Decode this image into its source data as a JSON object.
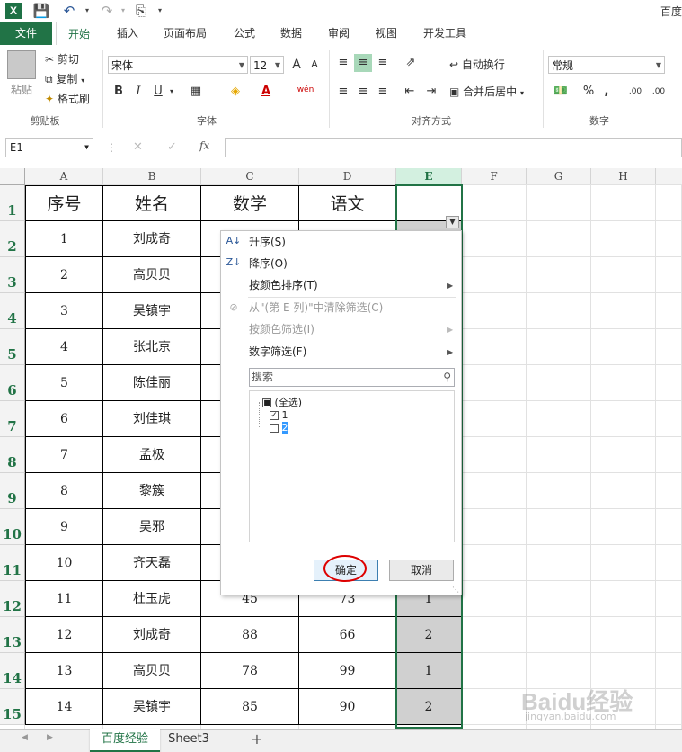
{
  "titlebar": {
    "app_icon": "X",
    "title_fragment": "百度",
    "icons": [
      "save-icon",
      "undo-icon",
      "redo-icon",
      "print-preview-icon",
      "customize-icon"
    ]
  },
  "tabs": [
    "文件",
    "开始",
    "插入",
    "页面布局",
    "公式",
    "数据",
    "审阅",
    "视图",
    "开发工具"
  ],
  "ribbon": {
    "clipboard": {
      "paste": "粘贴",
      "cut": "剪切",
      "copy": "复制",
      "format_painter": "格式刷",
      "label": "剪贴板"
    },
    "font": {
      "name": "宋体",
      "size": "12",
      "grow": "A",
      "shrink": "A",
      "bold": "B",
      "italic": "I",
      "underline": "U",
      "font_color": "A",
      "phonetic": "wén",
      "label": "字体"
    },
    "alignment": {
      "wrap": "自动换行",
      "merge": "合并后居中",
      "label": "对齐方式"
    },
    "number": {
      "format": "常规",
      "percent": "%",
      "comma": ",",
      "inc": ".00",
      "dec": ".00",
      "label": "数字"
    }
  },
  "formula_bar": {
    "name_box": "E1",
    "fx": "fx",
    "value": ""
  },
  "columns": [
    "A",
    "B",
    "C",
    "D",
    "E",
    "F",
    "G",
    "H"
  ],
  "rows": [
    "1",
    "2",
    "3",
    "4",
    "5",
    "6",
    "7",
    "8",
    "9",
    "10",
    "11",
    "12",
    "13",
    "14",
    "15"
  ],
  "table": {
    "headers": [
      "序号",
      "姓名",
      "数学",
      "语文",
      ""
    ],
    "records": [
      [
        "1",
        "刘成奇",
        "",
        "",
        ""
      ],
      [
        "2",
        "高贝贝",
        "",
        "",
        ""
      ],
      [
        "3",
        "吴镇宇",
        "",
        "",
        ""
      ],
      [
        "4",
        "张北京",
        "",
        "",
        ""
      ],
      [
        "5",
        "陈佳丽",
        "",
        "",
        ""
      ],
      [
        "6",
        "刘佳琪",
        "",
        "",
        ""
      ],
      [
        "7",
        "孟极",
        "",
        "",
        ""
      ],
      [
        "8",
        "黎簇",
        "",
        "",
        ""
      ],
      [
        "9",
        "吴邪",
        "",
        "",
        ""
      ],
      [
        "10",
        "齐天磊",
        "",
        "",
        ""
      ],
      [
        "11",
        "杜玉虎",
        "45",
        "73",
        "1"
      ],
      [
        "12",
        "刘成奇",
        "88",
        "66",
        "2"
      ],
      [
        "13",
        "高贝贝",
        "78",
        "99",
        "1"
      ],
      [
        "14",
        "吴镇宇",
        "85",
        "90",
        "2"
      ]
    ]
  },
  "filter_menu": {
    "sort_asc": "升序(S)",
    "sort_desc": "降序(O)",
    "sort_color": "按颜色排序(T)",
    "clear_filter": "从\"(第 E 列)\"中清除筛选(C)",
    "filter_color": "按颜色筛选(I)",
    "number_filter": "数字筛选(F)",
    "search_placeholder": "搜索",
    "items": [
      {
        "label": "(全选)",
        "state": "partial"
      },
      {
        "label": "1",
        "state": "checked"
      },
      {
        "label": "2",
        "state": "unchecked"
      }
    ],
    "ok": "确定",
    "cancel": "取消"
  },
  "sheets": {
    "active": "百度经验",
    "other": "Sheet3",
    "add": "+"
  },
  "watermark": "Baidu经验 jingyan.baidu.com"
}
